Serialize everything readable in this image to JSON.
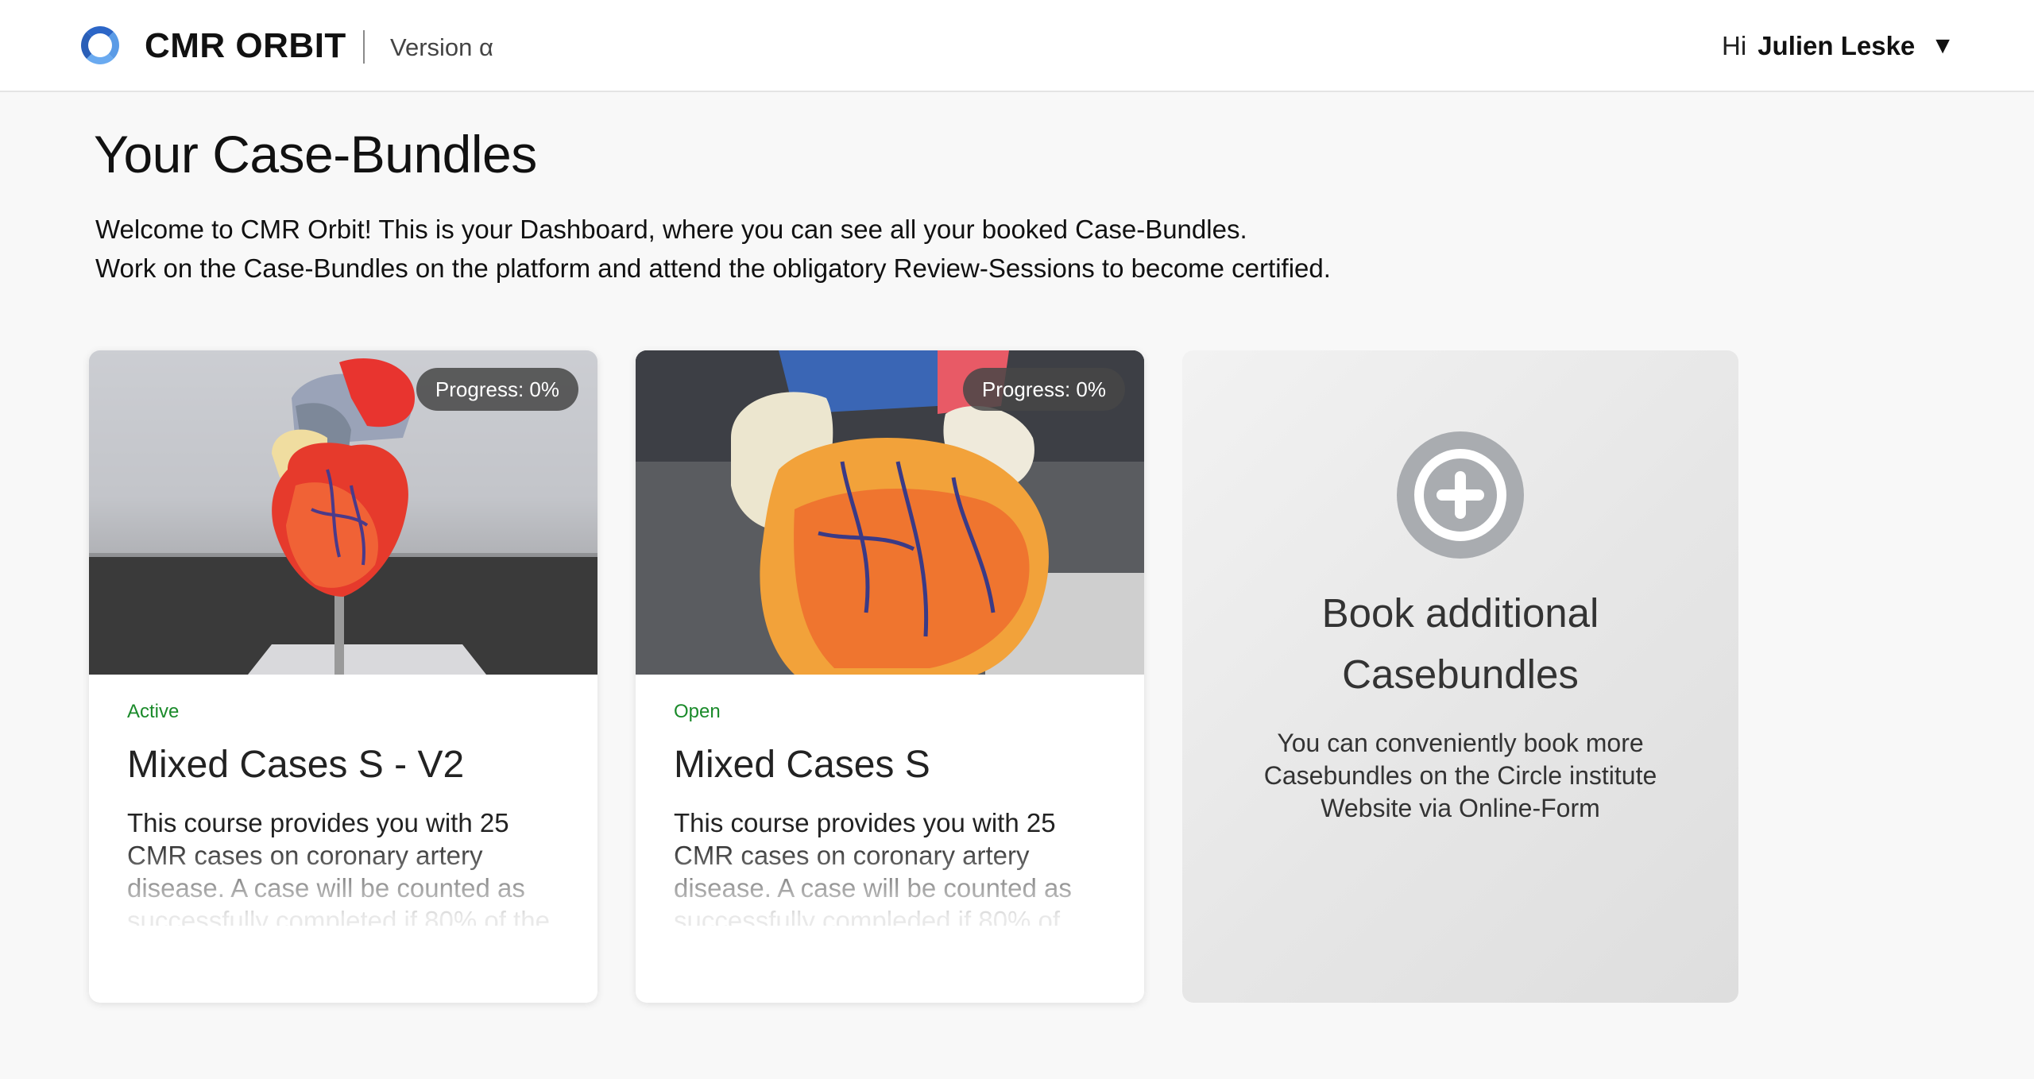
{
  "header": {
    "brand": "CMR ORBIT",
    "version": "Version α",
    "greeting": "Hi",
    "user_name": "Julien Leske",
    "user_caret": "▼"
  },
  "page": {
    "title": "Your Case-Bundles",
    "intro_line1": "Welcome to CMR Orbit! This is your Dashboard, where you can see all your booked Case-Bundles.",
    "intro_line2": "Work on the Case-Bundles on the platform and attend the obligatory Review-Sessions to become certified."
  },
  "cards": [
    {
      "progress": "Progress: 0%",
      "status": "Active",
      "title": "Mixed Cases S - V2",
      "description": "This course provides you with 25 CMR cases on coronary artery disease. A case will be counted as successfully completed if 80% of the"
    },
    {
      "progress": "Progress: 0%",
      "status": "Open",
      "title": "Mixed Cases S",
      "description": "This course provides you with 25 CMR cases on coronary artery disease. A case will be counted as successfully compleded if 80% of"
    }
  ],
  "book": {
    "title": "Book additional Casebundles",
    "text": "You can conveniently book more Casebundles on the Circle institute Website via Online-Form",
    "icon": "plus-circle-icon"
  },
  "colors": {
    "status_green": "#1a8a2a",
    "logo_blue": "#3f7fd6",
    "badge_bg": "#464646"
  }
}
